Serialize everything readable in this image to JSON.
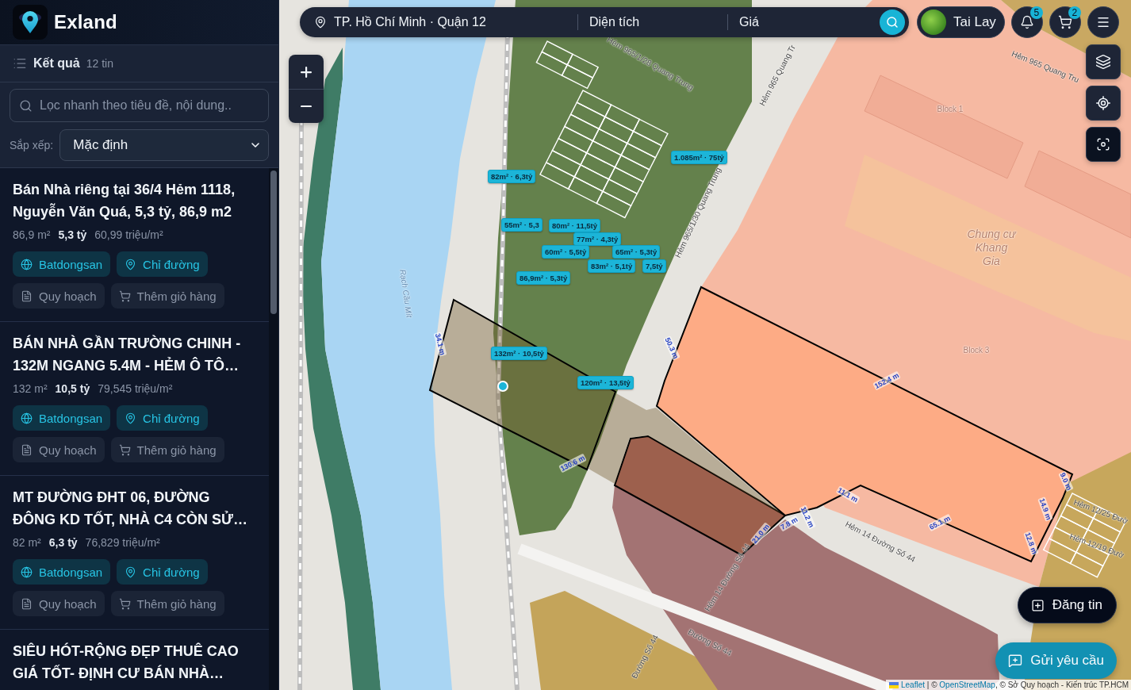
{
  "brand": {
    "name": "Exland"
  },
  "results": {
    "title": "Kết quả",
    "count": "12 tin"
  },
  "filter": {
    "placeholder": "Lọc nhanh theo tiêu đề, nội dung.."
  },
  "sort": {
    "label": "Sắp xếp:",
    "value": "Mặc định"
  },
  "listings": [
    {
      "title": "Bán Nhà riêng tại 36/4 Hẻm 1118, Nguyễn Văn Quá, 5,3 tỷ, 86,9 m2",
      "area": "86,9 m²",
      "price": "5,3 tỷ",
      "unit_price": "60,99 triệu/m²",
      "actions": [
        {
          "label": "Batdongsan",
          "kind": "source"
        },
        {
          "label": "Chỉ đường",
          "kind": "directions"
        },
        {
          "label": "Quy hoạch",
          "kind": "planning"
        },
        {
          "label": "Thêm giỏ hàng",
          "kind": "cart"
        }
      ]
    },
    {
      "title": "BÁN NHÀ GẦN TRƯỜNG CHINH - 132M NGANG 5.4M - HẺM Ô TÔ…",
      "area": "132 m²",
      "price": "10,5 tỷ",
      "unit_price": "79,545 triệu/m²",
      "actions": [
        {
          "label": "Batdongsan",
          "kind": "source"
        },
        {
          "label": "Chỉ đường",
          "kind": "directions"
        },
        {
          "label": "Quy hoạch",
          "kind": "planning"
        },
        {
          "label": "Thêm giỏ hàng",
          "kind": "cart"
        }
      ]
    },
    {
      "title": "MT ĐƯỜNG ĐHT 06, ĐƯỜNG ĐÔNG KD TỐT, NHÀ C4 CÒN SỬ…",
      "area": "82 m²",
      "price": "6,3 tỷ",
      "unit_price": "76,829 triệu/m²",
      "actions": [
        {
          "label": "Batdongsan",
          "kind": "source"
        },
        {
          "label": "Chỉ đường",
          "kind": "directions"
        },
        {
          "label": "Quy hoạch",
          "kind": "planning"
        },
        {
          "label": "Thêm giỏ hàng",
          "kind": "cart"
        }
      ]
    },
    {
      "title": "SIÊU HÓT-RỘNG ĐẸP THUÊ CAO GIÁ TỐT- ĐỊNH CƯ BÁN NHÀ…"
    }
  ],
  "search_bar": {
    "location": "TP. Hồ Chí Minh · Quận 12",
    "area": "Diện tích",
    "price": "Giá"
  },
  "user": {
    "name": "Tai Lay"
  },
  "notifications": {
    "count": "5"
  },
  "cart": {
    "count": "2"
  },
  "map": {
    "price_tags": [
      "82m² · 6,3tỷ",
      "1.085m² · 75tỷ",
      "55m² · 5,3",
      "80m² · 11,5tỷ",
      "77m² · 4,3tỷ",
      "65m² · 5,3tỷ",
      "60m² · 5,5tỷ",
      "83m² · 5,1tỷ",
      "7,5tỷ",
      "86,9m² · 5,3tỷ",
      "132m² · 10,5tỷ",
      "120m² · 13,5tỷ"
    ],
    "labels": [
      {
        "text": "Hẻm 965/1/28 Quang Trung",
        "kind": "street"
      },
      {
        "text": "Hẻm 965 Quang Tr",
        "kind": "street"
      },
      {
        "text": "Hẻm 965 Quang Tru",
        "kind": "street"
      },
      {
        "text": "Hẻm 965/1/30 Quang Trung",
        "kind": "street"
      },
      {
        "text": "Rạch Cầu Mít",
        "kind": "water"
      },
      {
        "text": "Block 1",
        "kind": "block"
      },
      {
        "text": "Chung cư Khang Gia",
        "kind": "place"
      },
      {
        "text": "Block 3",
        "kind": "block"
      },
      {
        "text": "Hẻm 14 Đường Số 44",
        "kind": "street"
      },
      {
        "text": "Hẻm 14 Đường Số 44",
        "kind": "street"
      },
      {
        "text": "Đường Số 44",
        "kind": "street"
      },
      {
        "text": "Đường Số 44",
        "kind": "street"
      },
      {
        "text": "Hẻm 12/25 Đườ",
        "kind": "street"
      },
      {
        "text": "Hẻm 12/19 Đườ",
        "kind": "street"
      }
    ],
    "measurements": [
      "34.1 m",
      "50.3 m",
      "152.4 m",
      "130.6 m",
      "11.1 m",
      "65.1 m",
      "9.0 m",
      "14.9 m",
      "12.8 m",
      "21.0 m",
      "7.8 m",
      "11.2 m"
    ]
  },
  "post_button": {
    "label": "Đăng tin"
  },
  "request_button": {
    "label": "Gửi yêu cầu"
  },
  "attribution": [
    {
      "kind": "link",
      "text": "Leaflet"
    },
    {
      "kind": "text",
      "text": " | © "
    },
    {
      "kind": "link",
      "text": "OpenStreetMap"
    },
    {
      "kind": "text",
      "text": ", © Sở Quy hoạch - Kiến trúc TP.HCM"
    }
  ]
}
